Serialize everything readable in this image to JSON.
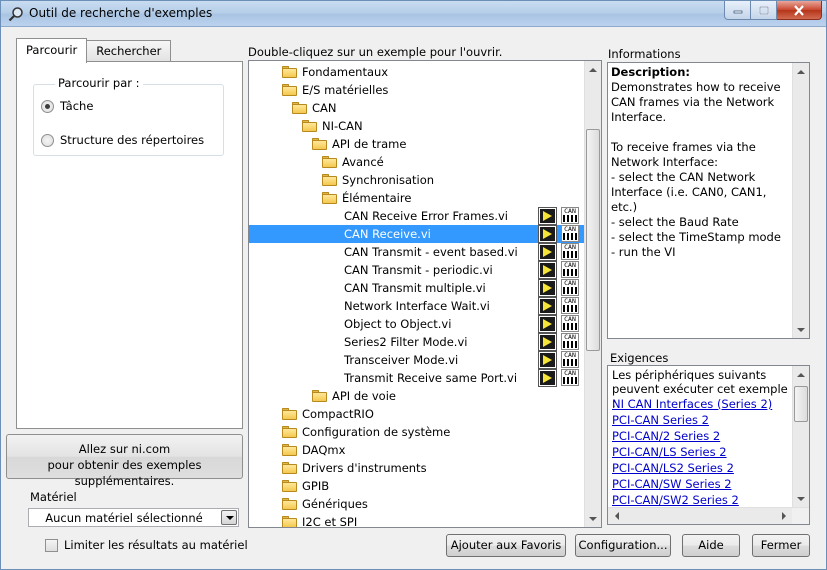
{
  "window": {
    "title": "Outil de recherche d'exemples",
    "title_icon": "search-icon",
    "controls": [
      "minimize-icon",
      "maximize-icon",
      "close-icon"
    ]
  },
  "tabs": [
    {
      "label": "Parcourir",
      "active": true
    },
    {
      "label": "Rechercher",
      "active": false
    }
  ],
  "browse": {
    "group_label": "Parcourir par :",
    "options": [
      {
        "label": "Tâche",
        "checked": true
      },
      {
        "label": "Structure des répertoires",
        "checked": false
      }
    ]
  },
  "ni_button": {
    "line1": "Allez sur ni.com",
    "line2": "pour obtenir des exemples supplémentaires."
  },
  "hardware": {
    "label": "Matériel",
    "selected": "Aucun matériel sélectionné",
    "limit_label": "Limiter les résultats au matériel",
    "limit_checked": false
  },
  "tree": {
    "header": "Double-cliquez sur un exemple pour l'ouvrir.",
    "items": [
      {
        "label": "Fondamentaux",
        "type": "folder",
        "level": 0
      },
      {
        "label": "E/S matérielles",
        "type": "folder",
        "level": 0
      },
      {
        "label": "CAN",
        "type": "folder",
        "level": 1
      },
      {
        "label": "NI-CAN",
        "type": "folder",
        "level": 2
      },
      {
        "label": "API de trame",
        "type": "folder",
        "level": 3
      },
      {
        "label": "Avancé",
        "type": "folder",
        "level": 4
      },
      {
        "label": "Synchronisation",
        "type": "folder",
        "level": 4
      },
      {
        "label": "Élémentaire",
        "type": "folder",
        "level": 4
      },
      {
        "label": "CAN Receive Error Frames.vi",
        "type": "vi",
        "level": 5
      },
      {
        "label": "CAN Receive.vi",
        "type": "vi",
        "level": 5,
        "selected": true
      },
      {
        "label": "CAN Transmit - event based.vi",
        "type": "vi",
        "level": 5
      },
      {
        "label": "CAN Transmit - periodic.vi",
        "type": "vi",
        "level": 5
      },
      {
        "label": "CAN Transmit multiple.vi",
        "type": "vi",
        "level": 5
      },
      {
        "label": "Network Interface Wait.vi",
        "type": "vi",
        "level": 5
      },
      {
        "label": "Object to Object.vi",
        "type": "vi",
        "level": 5
      },
      {
        "label": "Series2 Filter Mode.vi",
        "type": "vi",
        "level": 5
      },
      {
        "label": "Transceiver Mode.vi",
        "type": "vi",
        "level": 5
      },
      {
        "label": "Transmit Receive same Port.vi",
        "type": "vi",
        "level": 5
      },
      {
        "label": "API de voie",
        "type": "folder",
        "level": 3
      },
      {
        "label": "CompactRIO",
        "type": "folder",
        "level": 0
      },
      {
        "label": "Configuration de système",
        "type": "folder",
        "level": 0
      },
      {
        "label": "DAQmx",
        "type": "folder",
        "level": 0
      },
      {
        "label": "Drivers d'instruments",
        "type": "folder",
        "level": 0
      },
      {
        "label": "GPIB",
        "type": "folder",
        "level": 0
      },
      {
        "label": "Génériques",
        "type": "folder",
        "level": 0
      },
      {
        "label": "I2C et SPI",
        "type": "folder",
        "level": 0
      }
    ],
    "icon_names": {
      "folder": "folder-icon",
      "vi_run": "vi-run-icon",
      "vi_can": "can-vi-icon"
    },
    "can_icon_text": "CAN"
  },
  "info": {
    "label": "Informations",
    "heading": "Description:",
    "body": "Demonstrates how to receive CAN frames via the Network Interface.\n\nTo receive frames via the Network Interface:\n- select the CAN Network Interface (i.e. CAN0, CAN1, etc.)\n- select the Baud Rate\n- select the TimeStamp mode\n- run the VI"
  },
  "requirements": {
    "label": "Exigences",
    "intro": "Les périphériques suivants peuvent exécuter cet exemple :",
    "links": [
      "NI CAN Interfaces (Series 2)",
      "PCI-CAN Series 2",
      "PCI-CAN/2 Series 2",
      "PCI-CAN/LS Series 2",
      "PCI-CAN/LS2 Series 2",
      "PCI-CAN/SW Series 2",
      "PCI-CAN/SW2 Series 2"
    ]
  },
  "buttons": {
    "favorites": "Ajouter aux Favoris",
    "configuration": "Configuration...",
    "help": "Aide",
    "close": "Fermer"
  },
  "colors": {
    "selection": "#3399ff",
    "link": "#0000cc",
    "titlebar": "#b7cfe9",
    "close_button": "#c9462f"
  }
}
